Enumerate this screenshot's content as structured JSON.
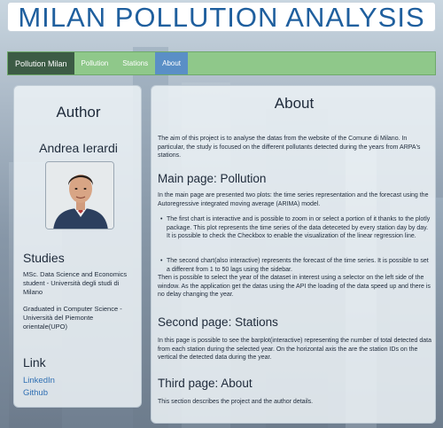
{
  "banner": {
    "title": "MILAN POLLUTION ANALYSIS"
  },
  "navbar": {
    "brand": "Pollution Milan",
    "items": [
      {
        "label": "Pollution",
        "active": false
      },
      {
        "label": "Stations",
        "active": false
      },
      {
        "label": "About",
        "active": true
      }
    ]
  },
  "author": {
    "heading": "Author",
    "name": "Andrea Ierardi",
    "photo_icon": "author-photo",
    "studies_heading": "Studies",
    "studies": [
      "MSc. Data Science and Economics student - Università degli studi di Milano",
      "Graduated in Computer Science - Università del Piemonte orientale(UPO)"
    ],
    "link_heading": "Link",
    "links": [
      "LinkedIn",
      "Github"
    ]
  },
  "about": {
    "heading": "About",
    "intro": "The aim of this project is to analyse the datas from the website of the Comune di Milano. In particular, the study is focused on the different pollutants detected during the years from ARPA's stations.",
    "main_heading": "Main page: Pollution",
    "main_text": "In the main page are presented two plots: the time series representation and the forecast using the Autoregressive integrated moving average (ARIMA) model.",
    "bullet_1": "The first chart is interactive and is possible to zoom in or select a portion of it thanks to the plotly package. This plot represents the time series of the data deteceted by every station day by day. It is possible to check the Checkbox to enable the visualization of the linear regression line.",
    "bullet_2": "The second chart(also interactive) represents the forecast of the time series. It is possible to set a different from 1 to 50 lags using the sidebar.",
    "after_text": "Then is possible to select the year of the dataset in interest using a selector on the left side of the window. As the application get the datas using the API the loading of the data speed up and there is no delay changing the year.",
    "second_heading": "Second page: Stations",
    "second_text": "In this page is possible to see the barplot(interactive) representing the number of total detected data from each station during the selected year. On the horizontal axis the are the station IDs on the vertical the detected data during the year.",
    "third_heading": "Third page: About",
    "third_text": "This section describes the project and the author details."
  }
}
